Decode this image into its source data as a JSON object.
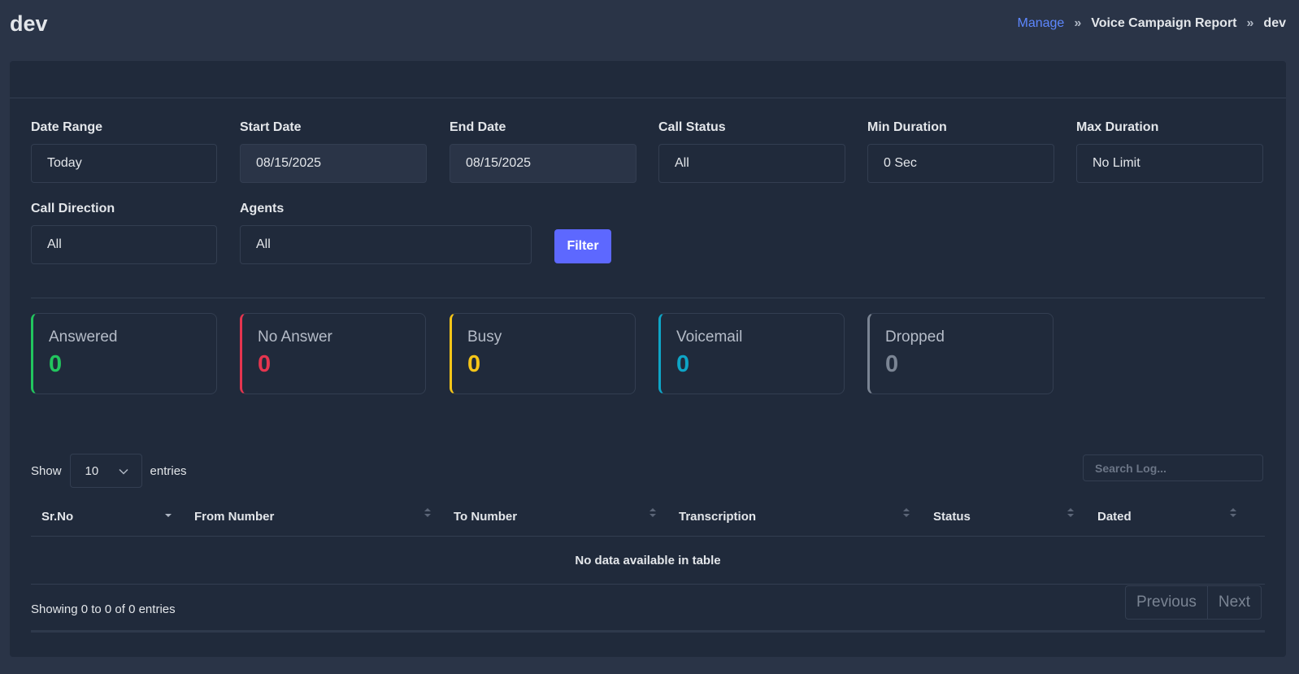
{
  "page": {
    "title": "dev"
  },
  "breadcrumb": {
    "manage": "Manage",
    "report": "Voice Campaign Report",
    "current": "dev"
  },
  "filters": {
    "date_range": {
      "label": "Date Range",
      "value": "Today"
    },
    "start_date": {
      "label": "Start Date",
      "value": "08/15/2025"
    },
    "end_date": {
      "label": "End Date",
      "value": "08/15/2025"
    },
    "call_status": {
      "label": "Call Status",
      "value": "All"
    },
    "min_duration": {
      "label": "Min Duration",
      "value": "0 Sec"
    },
    "max_duration": {
      "label": "Max Duration",
      "value": "No Limit"
    },
    "call_direction": {
      "label": "Call Direction",
      "value": "All"
    },
    "agents": {
      "label": "Agents",
      "value": "All"
    },
    "filter_button": "Filter"
  },
  "stats": [
    {
      "label": "Answered",
      "value": "0",
      "color": "#22c55e"
    },
    {
      "label": "No Answer",
      "value": "0",
      "color": "#e5354f"
    },
    {
      "label": "Busy",
      "value": "0",
      "color": "#f5c518"
    },
    {
      "label": "Voicemail",
      "value": "0",
      "color": "#0ea5c6"
    },
    {
      "label": "Dropped",
      "value": "0",
      "color": "#7b8594"
    }
  ],
  "table_controls": {
    "show_label": "Show",
    "entries_value": "10",
    "entries_label": "entries",
    "search_placeholder": "Search Log..."
  },
  "table": {
    "columns": [
      "Sr.No",
      "From Number",
      "To Number",
      "Transcription",
      "Status",
      "Dated"
    ],
    "empty_message": "No data available in table",
    "info": "Showing 0 to 0 of 0 entries"
  },
  "pagination": {
    "previous": "Previous",
    "next": "Next"
  }
}
